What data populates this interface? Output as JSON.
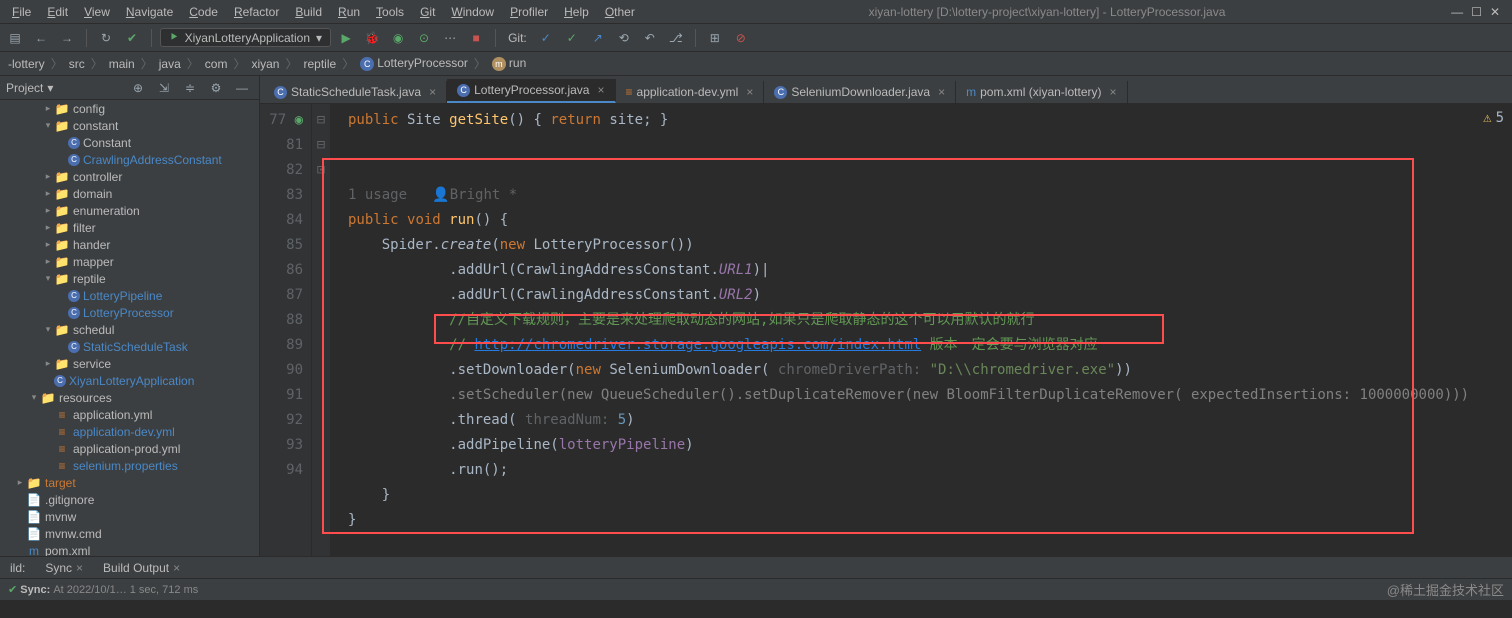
{
  "menu": [
    "File",
    "Edit",
    "View",
    "Navigate",
    "Code",
    "Refactor",
    "Build",
    "Run",
    "Tools",
    "Git",
    "Window",
    "Profiler",
    "Help",
    "Other"
  ],
  "title": "xiyan-lottery [D:\\lottery-project\\xiyan-lottery] - LotteryProcessor.java",
  "runConfig": "XiyanLotteryApplication",
  "git_label": "Git:",
  "breadcrumb": [
    "-lottery",
    "src",
    "main",
    "java",
    "com",
    "xiyan",
    "reptile",
    "LotteryProcessor",
    "run"
  ],
  "project_label": "Project",
  "tree": [
    {
      "depth": 3,
      "arrow": ">",
      "type": "folder",
      "label": "config"
    },
    {
      "depth": 3,
      "arrow": "v",
      "type": "folder",
      "label": "constant"
    },
    {
      "depth": 4,
      "arrow": " ",
      "type": "class",
      "label": "Constant"
    },
    {
      "depth": 4,
      "arrow": " ",
      "type": "class",
      "label": "CrawlingAddressConstant",
      "highlight": true
    },
    {
      "depth": 3,
      "arrow": ">",
      "type": "folder",
      "label": "controller"
    },
    {
      "depth": 3,
      "arrow": ">",
      "type": "folder",
      "label": "domain"
    },
    {
      "depth": 3,
      "arrow": ">",
      "type": "folder",
      "label": "enumeration"
    },
    {
      "depth": 3,
      "arrow": ">",
      "type": "folder",
      "label": "filter"
    },
    {
      "depth": 3,
      "arrow": ">",
      "type": "folder",
      "label": "hander"
    },
    {
      "depth": 3,
      "arrow": ">",
      "type": "folder",
      "label": "mapper"
    },
    {
      "depth": 3,
      "arrow": "v",
      "type": "folder",
      "label": "reptile"
    },
    {
      "depth": 4,
      "arrow": " ",
      "type": "class",
      "label": "LotteryPipeline",
      "highlight": true
    },
    {
      "depth": 4,
      "arrow": " ",
      "type": "class",
      "label": "LotteryProcessor",
      "highlight": true
    },
    {
      "depth": 3,
      "arrow": "v",
      "type": "folder",
      "label": "schedul"
    },
    {
      "depth": 4,
      "arrow": " ",
      "type": "class",
      "label": "StaticScheduleTask",
      "highlight": true
    },
    {
      "depth": 3,
      "arrow": ">",
      "type": "folder",
      "label": "service"
    },
    {
      "depth": 3,
      "arrow": " ",
      "type": "class",
      "label": "XiyanLotteryApplication",
      "highlight": true
    },
    {
      "depth": 2,
      "arrow": "v",
      "type": "resfolder",
      "label": "resources"
    },
    {
      "depth": 3,
      "arrow": " ",
      "type": "yml",
      "label": "application.yml"
    },
    {
      "depth": 3,
      "arrow": " ",
      "type": "yml",
      "label": "application-dev.yml",
      "highlight": true
    },
    {
      "depth": 3,
      "arrow": " ",
      "type": "yml",
      "label": "application-prod.yml"
    },
    {
      "depth": 3,
      "arrow": " ",
      "type": "prop",
      "label": "selenium.properties",
      "highlight": true
    },
    {
      "depth": 1,
      "arrow": ">",
      "type": "tfolder",
      "label": "target"
    },
    {
      "depth": 1,
      "arrow": " ",
      "type": "file",
      "label": ".gitignore"
    },
    {
      "depth": 1,
      "arrow": " ",
      "type": "file",
      "label": "mvnw"
    },
    {
      "depth": 1,
      "arrow": " ",
      "type": "file",
      "label": "mvnw.cmd"
    },
    {
      "depth": 1,
      "arrow": " ",
      "type": "xml",
      "label": "pom.xml"
    }
  ],
  "tabs": [
    {
      "icon": "c",
      "label": "StaticScheduleTask.java",
      "active": false
    },
    {
      "icon": "c",
      "label": "LotteryProcessor.java",
      "active": true
    },
    {
      "icon": "y",
      "label": "application-dev.yml",
      "active": false
    },
    {
      "icon": "c",
      "label": "SeleniumDownloader.java",
      "active": false
    },
    {
      "icon": "m",
      "label": "pom.xml (xiyan-lottery)",
      "active": false
    }
  ],
  "lineStart": 77,
  "lineCount": 18,
  "inlay": {
    "usages": "1 usage",
    "author": "Bright *"
  },
  "code": {
    "l77": {
      "kw1": "public",
      "cls": "Site",
      "meth": "getSite",
      "p": "() { ",
      "kw2": "return",
      "v": " site; }"
    },
    "l81": {
      "kw1": "public",
      "kw2": "void",
      "meth": "run",
      "rest": "() {"
    },
    "l82": {
      "pre": "Spider.",
      "it": "create",
      "p": "(",
      "kw": "new",
      "cls": " LotteryProcessor())"
    },
    "l83_a": ".addUrl(CrawlingAddressConstant.",
    "l83_u": "URL1",
    "l83_c": ")|",
    "l84_a": ".addUrl(CrawlingAddressConstant.",
    "l84_u": "URL2",
    "l84_c": ")",
    "l85": "//自定义下载规则，主要是来处理爬取动态的网站,如果只是爬取静态的这个可以用默认的就行",
    "l86_a": "// ",
    "l86_link": "http://chromedriver.storage.googleapis.com/index.html",
    "l86_b": " 版本一定会要与浏览器对应",
    "l87_a": ".setDownloader(",
    "l87_kw": "new",
    "l87_cls": " SeleniumDownloader( ",
    "l87_hint": "chromeDriverPath: ",
    "l87_str": "\"D:\\\\chromedriver.exe\"",
    "l87_c": "))",
    "l88_a": ".setScheduler(",
    "l88_kw1": "new",
    "l88_b": " QueueScheduler().setDuplicateRemover(",
    "l88_kw2": "new",
    "l88_c": " BloomFilterDuplicateRemover( ",
    "l88_hint": "expectedInsertions: ",
    "l88_num": "1000000000",
    "l88_d": ")))",
    "l89_a": ".thread( ",
    "l89_hint": "threadNum: ",
    "l89_num": "5",
    "l89_b": ")",
    "l90_a": ".addPipeline(",
    "l90_v": "lotteryPipeline",
    "l90_b": ")",
    "l91": ".run();",
    "l92": "}",
    "l93": "}"
  },
  "bottom": {
    "build": "ild:",
    "sync": "Sync",
    "output": "Build Output"
  },
  "status": {
    "sync": "Sync:",
    "detail": "At 2022/10/1… 1 sec, 712 ms"
  },
  "watermark": "@稀土掘金技术社区",
  "warn": "5"
}
